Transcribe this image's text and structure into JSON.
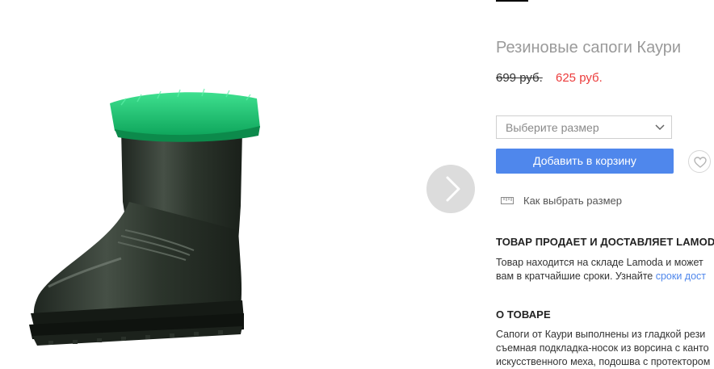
{
  "product": {
    "title": "Резиновые сапоги Каури",
    "old_price": "699 руб.",
    "new_price": "625 руб.",
    "image_alt_name": "rubber-boot-green-fur"
  },
  "purchase": {
    "size_placeholder": "Выберите размер",
    "add_to_cart_label": "Добавить в корзину",
    "size_guide_label": "Как выбрать размер"
  },
  "seller": {
    "heading": "ТОВАР ПРОДАЕТ И ДОСТАВЛЯЕТ LAMODA",
    "line1": "Товар находится на складе Lamoda и может",
    "line2_prefix": "вам в кратчайшие сроки. Узнайте ",
    "line2_link": "сроки дост"
  },
  "about": {
    "heading": "О ТОВАРЕ",
    "line1": "Сапоги от Каури выполнены из гладкой рези",
    "line2": "съемная подкладка-носок из ворсина с канто",
    "line3": "искусственного меха, подошва с протектором"
  },
  "colors": {
    "accent": "#4f87ec",
    "sale_price": "#ec3b3b",
    "title_gray": "#9a9a9a",
    "boot_fur": "#1fbf73",
    "boot_rubber": "#2f3a2f"
  },
  "icons": [
    "chevron-right-icon",
    "chevron-down-icon",
    "heart-icon",
    "ruler-icon"
  ]
}
